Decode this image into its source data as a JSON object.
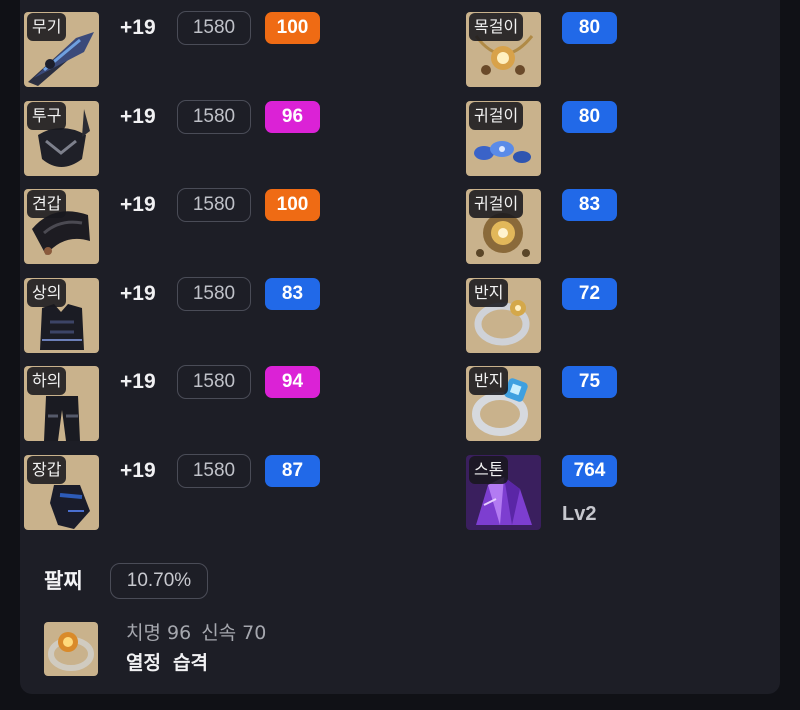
{
  "colors": {
    "quality_orange": "#ef6b14",
    "quality_magenta": "#db22d6",
    "quality_blue": "#2169e8"
  },
  "equipment": [
    {
      "slot": "무기",
      "enhance": "+19",
      "item_level": "1580",
      "quality": "100",
      "quality_color": "#ef6b14",
      "icon": "weapon-icon"
    },
    {
      "slot": "투구",
      "enhance": "+19",
      "item_level": "1580",
      "quality": "96",
      "quality_color": "#db22d6",
      "icon": "helmet-icon"
    },
    {
      "slot": "견갑",
      "enhance": "+19",
      "item_level": "1580",
      "quality": "100",
      "quality_color": "#ef6b14",
      "icon": "shoulder-icon"
    },
    {
      "slot": "상의",
      "enhance": "+19",
      "item_level": "1580",
      "quality": "83",
      "quality_color": "#2169e8",
      "icon": "chest-icon"
    },
    {
      "slot": "하의",
      "enhance": "+19",
      "item_level": "1580",
      "quality": "94",
      "quality_color": "#db22d6",
      "icon": "pants-icon"
    },
    {
      "slot": "장갑",
      "enhance": "+19",
      "item_level": "1580",
      "quality": "87",
      "quality_color": "#2169e8",
      "icon": "gloves-icon"
    }
  ],
  "accessories": [
    {
      "slot": "목걸이",
      "quality": "80",
      "icon": "necklace-icon"
    },
    {
      "slot": "귀걸이",
      "quality": "80",
      "icon": "earring-icon"
    },
    {
      "slot": "귀걸이",
      "quality": "83",
      "icon": "earring-icon"
    },
    {
      "slot": "반지",
      "quality": "72",
      "icon": "ring-icon"
    },
    {
      "slot": "반지",
      "quality": "75",
      "icon": "ring-icon"
    }
  ],
  "stone": {
    "slot": "스톤",
    "value": "764",
    "level": "Lv2",
    "icon": "ability-stone-icon"
  },
  "bracelet": {
    "title": "팔찌",
    "percent": "10.70%",
    "stats": [
      "치명 96",
      "신속 70"
    ],
    "effects": [
      "열정",
      "습격"
    ],
    "icon": "bracelet-icon"
  }
}
